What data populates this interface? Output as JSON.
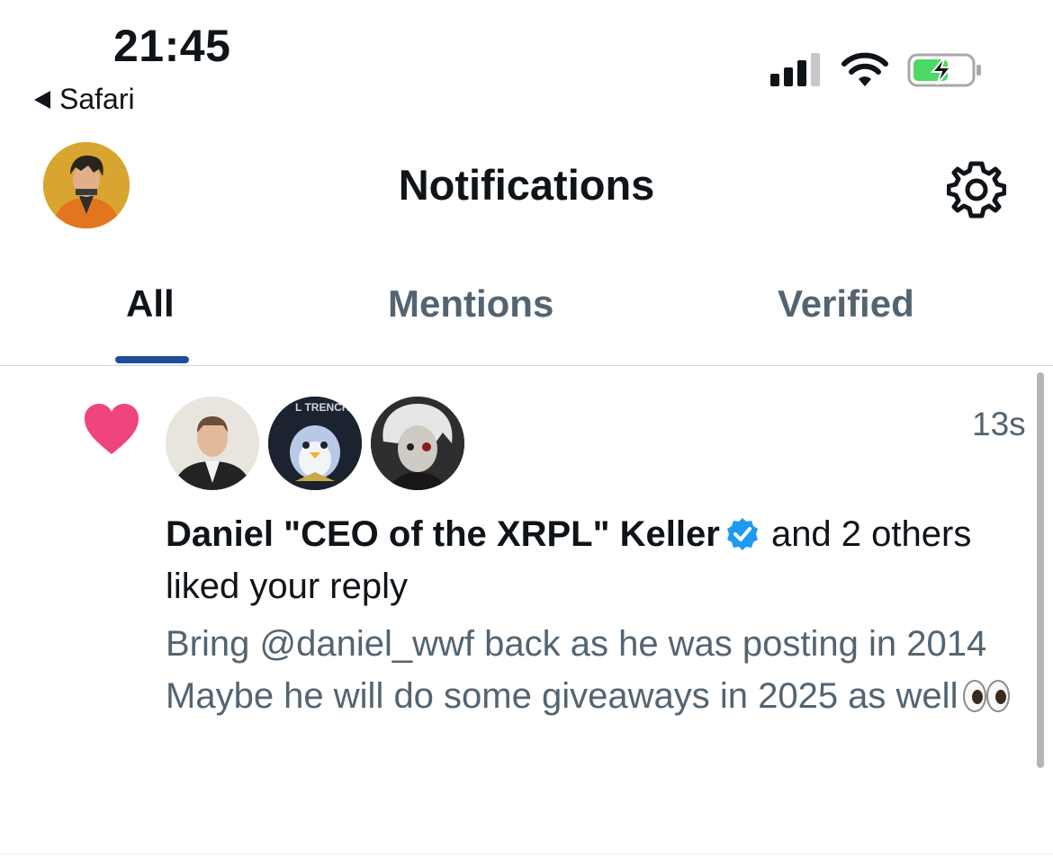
{
  "status_bar": {
    "time": "21:45",
    "back_app": "Safari",
    "icons": [
      "cellular-signal-icon",
      "wifi-icon",
      "battery-charging-icon"
    ]
  },
  "header": {
    "title": "Notifications",
    "icons": [
      "profile-avatar",
      "gear-icon"
    ]
  },
  "tabs": [
    {
      "label": "All",
      "active": true
    },
    {
      "label": "Mentions",
      "active": false
    },
    {
      "label": "Verified",
      "active": false
    }
  ],
  "notification": {
    "type_icon": "heart-icon",
    "time": "13s",
    "user_name": "Daniel \"CEO of the XRPL\" Keller",
    "action_text": " and 2 others liked your reply",
    "post_text": "Bring @daniel_wwf back as he was posting in 2014\nMaybe he will do some giveaways in 2025 as well",
    "avatar_labels": [
      "",
      "L TRENCH",
      ""
    ]
  },
  "colors": {
    "accent_blue": "#1d9bf0",
    "tab_indicator": "#1d4e9a",
    "like_pink": "#f0447e",
    "secondary_text": "#536471",
    "battery_green": "#4cd964"
  }
}
